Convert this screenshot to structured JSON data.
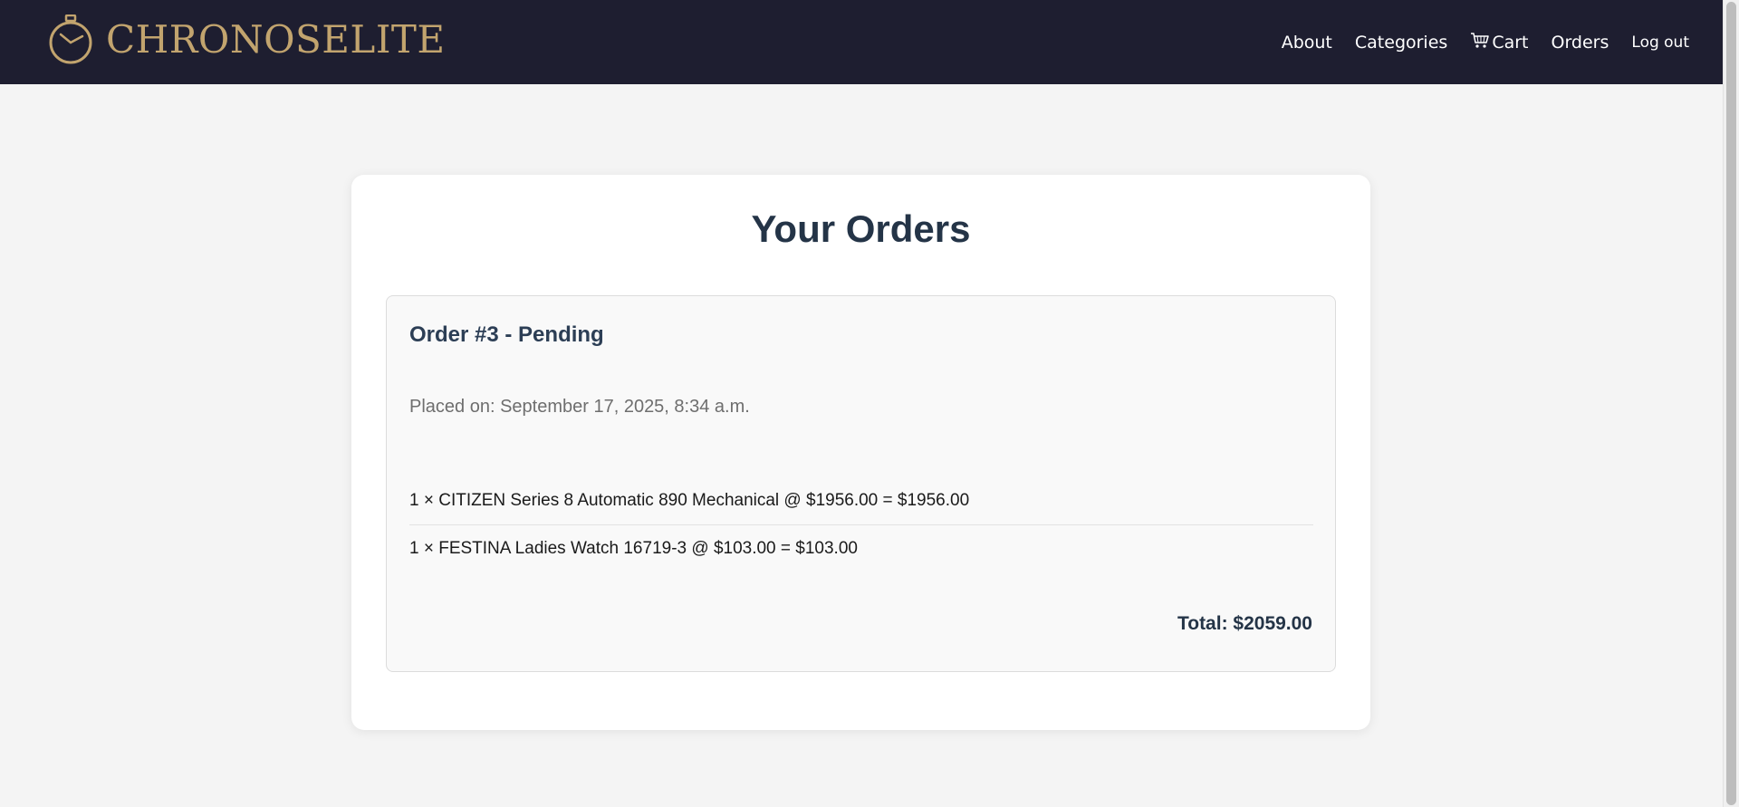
{
  "brand": {
    "name": "CHRONOSELITE",
    "logo_icon": "stopwatch-icon",
    "accent_color": "#c2a46e",
    "navbar_color": "#1e1e30"
  },
  "nav": {
    "about": "About",
    "categories": "Categories",
    "cart_icon": "cart-icon",
    "cart": "Cart",
    "orders": "Orders",
    "logout": "Log out"
  },
  "page": {
    "title": "Your Orders"
  },
  "orders": [
    {
      "heading": "Order #3 - Pending",
      "placed_on": "Placed on: September 17, 2025, 8:34 a.m.",
      "items": [
        "1 × CITIZEN Series 8 Automatic 890 Mechanical @ $1956.00 = $1956.00",
        "1 × FESTINA Ladies Watch 16719-3 @ $103.00 = $103.00"
      ],
      "total": "Total: $2059.00"
    }
  ]
}
